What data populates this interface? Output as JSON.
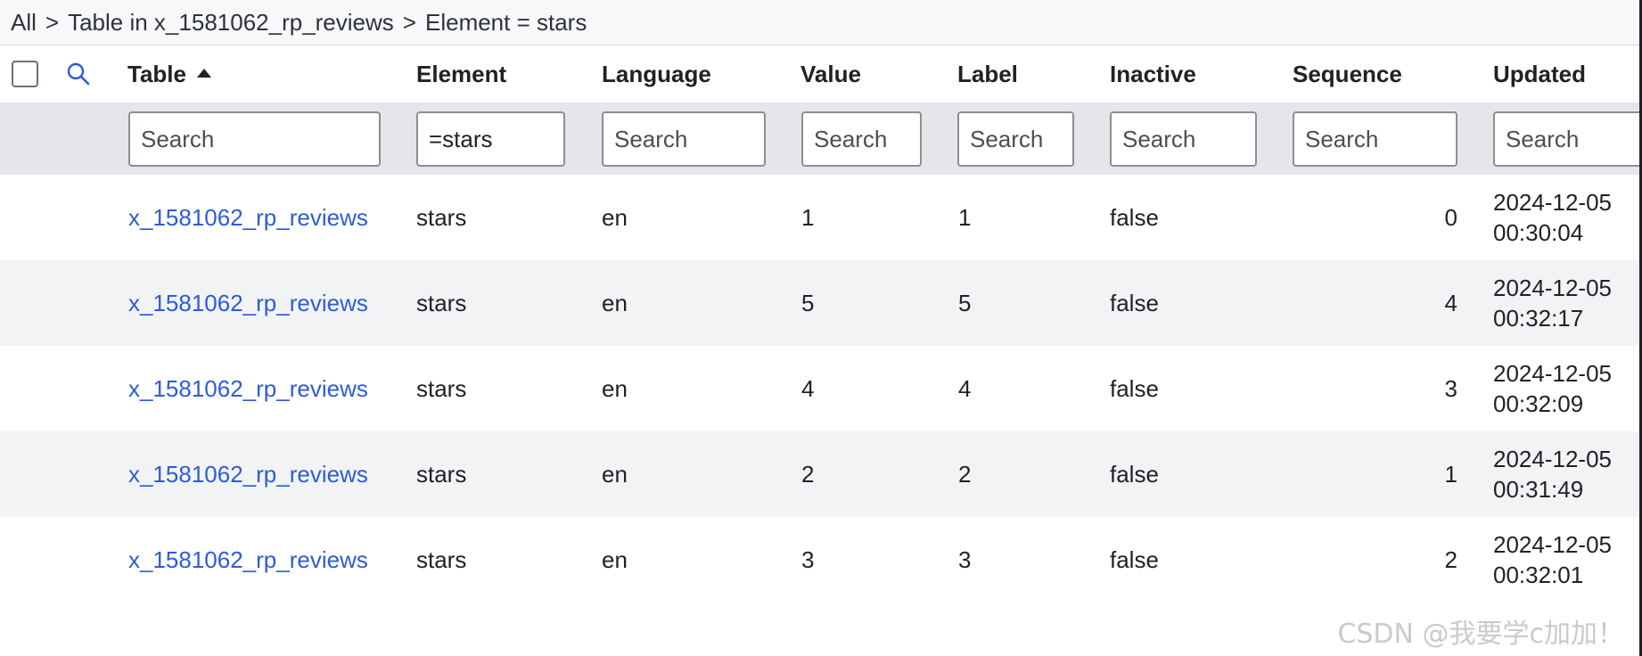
{
  "breadcrumb": {
    "items": [
      "All",
      "Table in x_1581062_rp_reviews",
      "Element = stars"
    ],
    "separator": ">"
  },
  "columns": {
    "table": "Table",
    "element": "Element",
    "language": "Language",
    "value": "Value",
    "label": "Label",
    "inactive": "Inactive",
    "sequence": "Sequence",
    "updated": "Updated"
  },
  "sort": {
    "column": "Table",
    "direction": "ascending"
  },
  "filters": {
    "table": {
      "value": "",
      "placeholder": "Search"
    },
    "element": {
      "value": "=stars",
      "placeholder": "Search"
    },
    "language": {
      "value": "",
      "placeholder": "Search"
    },
    "value": {
      "value": "",
      "placeholder": "Search"
    },
    "label": {
      "value": "",
      "placeholder": "Search"
    },
    "inactive": {
      "value": "",
      "placeholder": "Search"
    },
    "sequence": {
      "value": "",
      "placeholder": "Search"
    },
    "updated": {
      "value": "",
      "placeholder": "Search"
    }
  },
  "rows": [
    {
      "table": "x_1581062_rp_reviews",
      "element": "stars",
      "language": "en",
      "value": "1",
      "label": "1",
      "inactive": "false",
      "sequence": "0",
      "updated_date": "2024-12-05",
      "updated_time": "00:30:04"
    },
    {
      "table": "x_1581062_rp_reviews",
      "element": "stars",
      "language": "en",
      "value": "5",
      "label": "5",
      "inactive": "false",
      "sequence": "4",
      "updated_date": "2024-12-05",
      "updated_time": "00:32:17"
    },
    {
      "table": "x_1581062_rp_reviews",
      "element": "stars",
      "language": "en",
      "value": "4",
      "label": "4",
      "inactive": "false",
      "sequence": "3",
      "updated_date": "2024-12-05",
      "updated_time": "00:32:09"
    },
    {
      "table": "x_1581062_rp_reviews",
      "element": "stars",
      "language": "en",
      "value": "2",
      "label": "2",
      "inactive": "false",
      "sequence": "1",
      "updated_date": "2024-12-05",
      "updated_time": "00:31:49"
    },
    {
      "table": "x_1581062_rp_reviews",
      "element": "stars",
      "language": "en",
      "value": "3",
      "label": "3",
      "inactive": "false",
      "sequence": "2",
      "updated_date": "2024-12-05",
      "updated_time": "00:32:01"
    }
  ],
  "watermark": "CSDN @我要学c加加！",
  "colors": {
    "link": "#2e5bd8",
    "filter_row_bg": "#e4e6ea",
    "alt_row_bg": "#f2f3f5",
    "breadcrumb_bg": "#f7f8f9"
  },
  "icons": {
    "select_all": "checkbox-icon",
    "search_toggle": "search-icon",
    "sort": "sort-ascending-icon"
  }
}
